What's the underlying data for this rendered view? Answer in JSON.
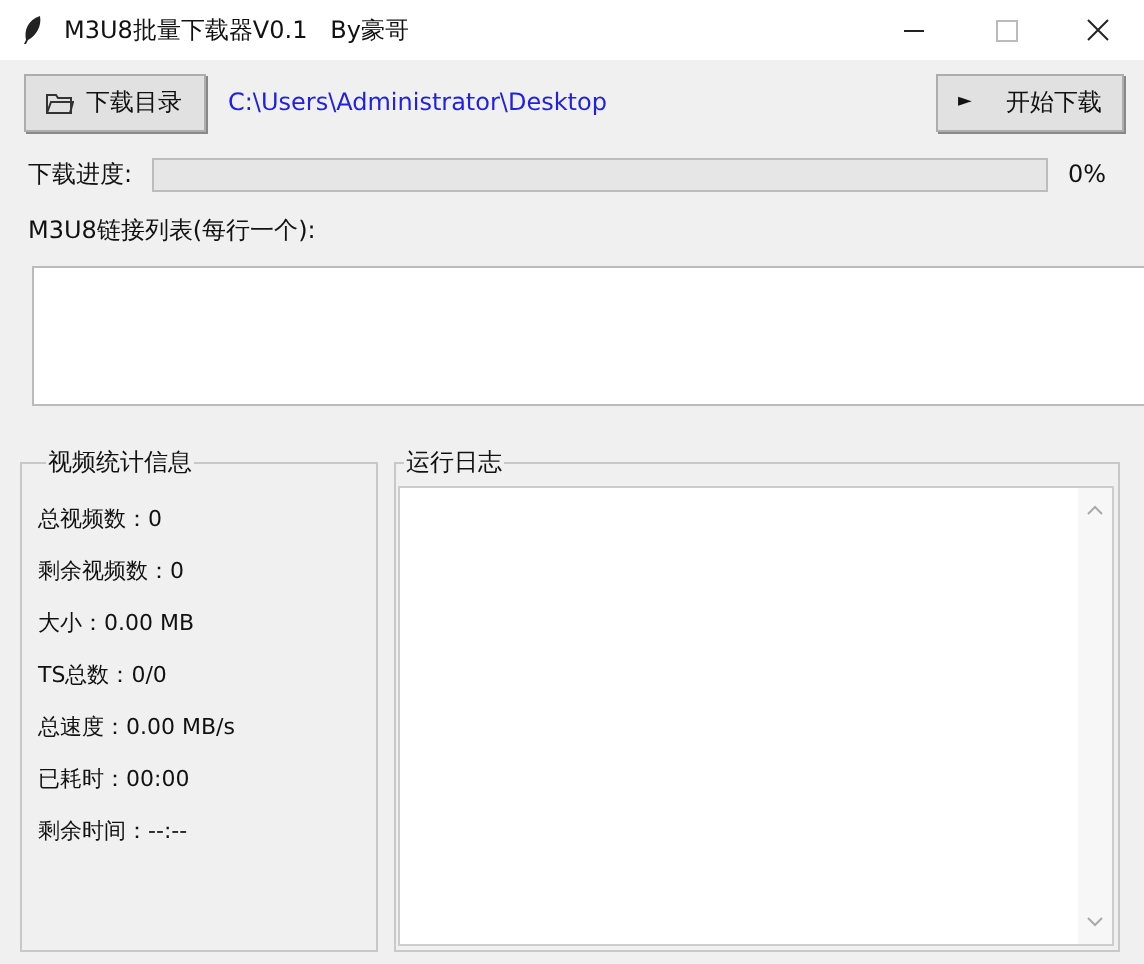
{
  "window": {
    "title": "M3U8批量下载器V0.1   By豪哥"
  },
  "toolbar": {
    "folder_button": "下载目录",
    "path": "C:\\Users\\Administrator\\Desktop",
    "start_button": "开始下载",
    "start_icon": "►"
  },
  "progress": {
    "label": "下载进度:",
    "level": 0,
    "reading": "0%"
  },
  "links": {
    "label": "M3U8链接列表(每行一个):"
  },
  "stats": {
    "title": "视频统计信息",
    "items": [
      {
        "text": "总视频数：0"
      },
      {
        "text": "剩余视频数：0"
      },
      {
        "text": "大小：0.00 MB"
      },
      {
        "text": "TS总数：0/0"
      },
      {
        "text": "总速度：0.00 MB/s"
      },
      {
        "text": "已耗时：00:00"
      },
      {
        "text": "剩余时间：--:--"
      }
    ]
  },
  "log": {
    "title": "运行日志"
  }
}
